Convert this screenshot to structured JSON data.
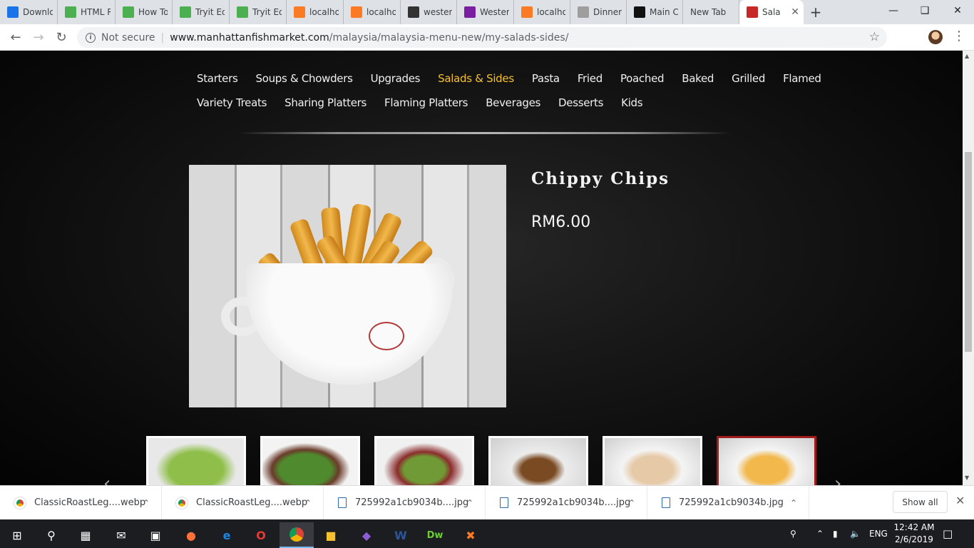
{
  "tabs": [
    {
      "title": "Downlo",
      "icon": "download-icon",
      "color": "#1a73e8"
    },
    {
      "title": "HTML R",
      "icon": "w3schools-icon",
      "color": "#4caf50"
    },
    {
      "title": "How To",
      "icon": "w3schools-icon",
      "color": "#4caf50"
    },
    {
      "title": "Tryit Ed",
      "icon": "w3schools-icon",
      "color": "#4caf50"
    },
    {
      "title": "Tryit Ed",
      "icon": "w3schools-icon",
      "color": "#4caf50"
    },
    {
      "title": "localhos",
      "icon": "xampp-icon",
      "color": "#fb7a24"
    },
    {
      "title": "localhos",
      "icon": "xampp-icon",
      "color": "#fb7a24"
    },
    {
      "title": "western",
      "icon": "bitbucket-icon",
      "color": "#333333"
    },
    {
      "title": "Western",
      "icon": "gallery-icon",
      "color": "#7b1fa2"
    },
    {
      "title": "localhos",
      "icon": "xampp-icon",
      "color": "#fb7a24"
    },
    {
      "title": "Dinner",
      "icon": "dinner-icon",
      "color": "#9e9e9e"
    },
    {
      "title": "Main Co",
      "icon": "scribd-icon",
      "color": "#111111"
    },
    {
      "title": "New Tab",
      "icon": "",
      "color": ""
    },
    {
      "title": "Sala",
      "icon": "manhattan-icon",
      "color": "#c62828"
    }
  ],
  "address": {
    "security": "Not secure",
    "host": "www.manhattanfishmarket.com",
    "path": "/malaysia/malaysia-menu-new/my-salads-sides/"
  },
  "menu": {
    "row1": [
      "Starters",
      "Soups & Chowders",
      "Upgrades",
      "Salads & Sides",
      "Pasta",
      "Fried",
      "Poached",
      "Baked",
      "Grilled",
      "Flamed"
    ],
    "row2": [
      "Variety Treats",
      "Sharing Platters",
      "Flaming Platters",
      "Beverages",
      "Desserts",
      "Kids"
    ],
    "active": "Salads & Sides",
    "active_color": "#f6c02e"
  },
  "product": {
    "title": "Chippy Chips",
    "price": "RM6.00"
  },
  "thumbnails": [
    {
      "name": "caesar-salad",
      "selected": false
    },
    {
      "name": "garden-salad",
      "selected": false
    },
    {
      "name": "mixed-salad",
      "selected": false
    },
    {
      "name": "mashed-potato",
      "selected": false
    },
    {
      "name": "rice-bowl",
      "selected": false
    },
    {
      "name": "chippy-chips",
      "selected": true
    }
  ],
  "downloads": [
    {
      "name": "ClassicRoastLeg....webp",
      "type": "chrome"
    },
    {
      "name": "ClassicRoastLeg....webp",
      "type": "chrome"
    },
    {
      "name": "725992a1cb9034b....jpg",
      "type": "file"
    },
    {
      "name": "725992a1cb9034b....jpg",
      "type": "file"
    },
    {
      "name": "725992a1cb9034b.jpg",
      "type": "file"
    }
  ],
  "downloads_bar": {
    "show_all": "Show all"
  },
  "taskbar": {
    "lang": "ENG",
    "time": "12:42 AM",
    "date": "2/6/2019"
  },
  "colors": {
    "accent_red": "#a01c1c",
    "menu_text": "#f0f0f0"
  }
}
